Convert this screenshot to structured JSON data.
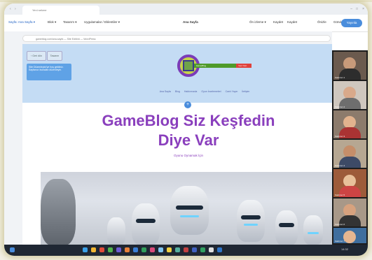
{
  "browser": {
    "tab_title": "Yeni sekme",
    "url": "localhost/wordpress/wp-admin"
  },
  "editor_toolbar": {
    "items": [
      "Sayfa: Ana Sayfa ▾",
      "Blok ▾",
      "Tasarım ▾",
      "Uygulamalar / Eklentiler ▾"
    ],
    "center_label": "Ana Sayfa",
    "right_items": [
      "Ön izleme ▾",
      "Kaydet",
      "Kaydet",
      "Önizle",
      "Gönder"
    ],
    "publish_label": "Yayınla"
  },
  "inner_browser": {
    "url": "gameblog.com/ana-sayfa — Site Editörü — WordPress"
  },
  "page_header": {
    "back_button": "‹ Geri dön",
    "toggle_button": "Tasarım",
    "notice_text": "Site Düzenleyici'ye hoş geldiniz. Sayfanızı buradan düzenleyin.",
    "logo_text": "GameBlog",
    "logo_red_text": "Yeni Yazı",
    "nav": [
      "Ana Sayfa",
      "Blog",
      "Hakkımızda",
      "Oyun İncelemeleri",
      "Canlı Yayın",
      "İletişim"
    ]
  },
  "hero": {
    "title_line1": "GameBlog Siz Keşfedin",
    "title_line2": "Diye Var",
    "subtitle": "Oyunu Oynamak İçin"
  },
  "video_call": {
    "participants": [
      "Katılımcı 1",
      "Katılımcı 2",
      "Katılımcı 3",
      "Katılımcı 4",
      "Katılımcı 5",
      "Katılımcı 6",
      "Katılımcı 7"
    ]
  },
  "taskbar": {
    "time": "14:32"
  }
}
